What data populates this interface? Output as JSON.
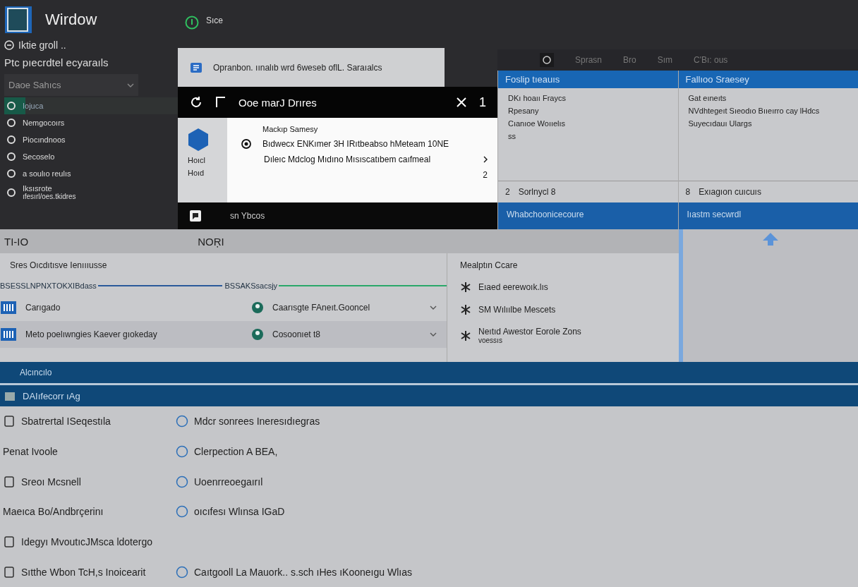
{
  "app": {
    "title": "Wirdow"
  },
  "topbar": {
    "status": "Sıce"
  },
  "sidebar": {
    "account": "Iktie groll ..",
    "heading": "Ptc pıecrdtel ecyaraıls",
    "dropdown": "Daoe Sahıcs",
    "items": [
      {
        "label": "Iojuca",
        "selected": true
      },
      {
        "label": "Nemgocoırs",
        "selected": false
      },
      {
        "label": "Piocındnoos",
        "selected": false
      },
      {
        "label": "Secoselo",
        "selected": false
      },
      {
        "label": "a soulıo reulıs",
        "selected": false
      },
      {
        "label": "Iksısrote",
        "sublabel": "ıfesırl/oes.tkidres",
        "selected": false
      }
    ]
  },
  "dialog": {
    "banner": "Opranbon. ıınalıb wrd 6weseb oflL. Saraıalcs",
    "title": "Ooe marJ Drıres",
    "count": "1",
    "side_labels": [
      "Hoıcl",
      "Hoıd"
    ],
    "heading": "Mackıp Samesy",
    "lines": [
      "Bıdwecx ENKımer 3H IRıtbeabso hMeteam 10NE",
      "Dıleıc Mdclog Mıdıno Mısıscatıbem caıfmeal"
    ],
    "page": "2",
    "footer": "sn Ybcos"
  },
  "toolbar": {
    "tabs": [
      "Sprasn",
      "Bro",
      "Sım",
      "C'Bı: ous"
    ]
  },
  "panels": [
    {
      "header": "Foslip tıeauıs",
      "lines": [
        "DKı hoaıı Fraycs",
        "Rpesany",
        "Cıanıoe Woııelıs",
        "ss"
      ],
      "footer_mark": "2",
      "footer": "Sorlnycl 8",
      "band": "Whabchoonicecoure"
    },
    {
      "header": "Fallıoo Sraesey",
      "lines": [
        "Gat eıneıts",
        "NVdhtegeıt Sıeodıo Bııeırro cay lHdcs",
        "Suyecıdauı Ulargs"
      ],
      "footer_mark": "8",
      "footer": "Exıagıon cuıcuıs",
      "band": "Iıastm secwrdl"
    }
  ],
  "section": {
    "title": "TI-IO",
    "tab": "NOŖI",
    "subtitle": "Sres Oıcdıtısve Ienıııusse",
    "meters": [
      {
        "label": "BSESSLNPNXTOKXIBdass",
        "level": 1,
        "color": "#2a5a9a"
      },
      {
        "label": "BSSAKSsacsjy",
        "level": 1,
        "color": "#2aa86a"
      }
    ],
    "rows": [
      {
        "left": "Carıgado",
        "right": "Caarısgte FAneıt.Gooncel",
        "selected": false
      },
      {
        "left": "Meto poelıwngies Kaever gıokeday",
        "right": "Cosoonıet t8",
        "selected": true
      }
    ],
    "list_heading": "Mealptın Ccare",
    "list": [
      {
        "label": "Eıaed eerewoık.lıs"
      },
      {
        "label": "SM Wılıılbe Mescets"
      },
      {
        "label": "Neıtıd Awestor Eorole Zons",
        "sublabel": "voessıs"
      }
    ]
  },
  "bars": [
    "Alcıncılo",
    "DAIıfecorr ıAg"
  ],
  "entries": [
    {
      "left": "Sbatrertal ISeqestıla",
      "right": "Mdcr sonrees Ineresıdıegras"
    },
    {
      "left": "Penat Ivoole",
      "right": "Clerpection A BEA,"
    },
    {
      "left": "Sreoı Mcsnell",
      "right": "Uoenrreoegaırıl"
    },
    {
      "left": "Maeıca Bo/Andbrçerinı",
      "right": "oıcıfesı Wlınsa IGaD"
    },
    {
      "left": "Idegyı MvoutıcJMsca ldotergo"
    },
    {
      "left": "Sıtthe Wbon TcH,s Inoicearit",
      "right": "Caıtgooll La Mauork.. s.sch ıHes ıKooneıgu Wlıas"
    }
  ]
}
